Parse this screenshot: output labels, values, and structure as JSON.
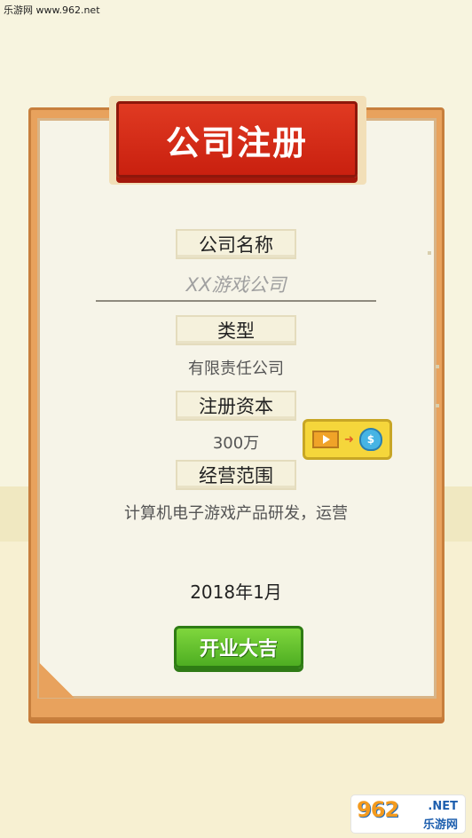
{
  "watermark": {
    "top_text": "乐游网 www.962.net",
    "logo_number": "962",
    "logo_suffix": ".NET",
    "logo_cn": "乐游网"
  },
  "form": {
    "title": "公司注册",
    "company_name_label": "公司名称",
    "company_name_placeholder": "XX游戏公司",
    "type_label": "类型",
    "type_value": "有限责任公司",
    "capital_label": "注册资本",
    "capital_value": "300万",
    "scope_label": "经营范围",
    "scope_value": "计算机电子游戏产品研发，运营",
    "date": "2018年1月",
    "submit_label": "开业大吉"
  },
  "ad_button": {
    "icons": [
      "video-icon",
      "arrow-icon",
      "money-bag-icon"
    ],
    "money_symbol": "$"
  },
  "colors": {
    "title_red": "#d42b17",
    "card_orange": "#e8a25d",
    "button_green": "#5cbf2a",
    "ad_yellow": "#f5d63b"
  }
}
